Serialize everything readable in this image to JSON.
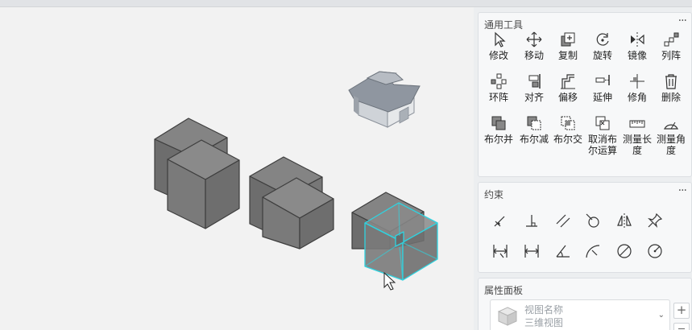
{
  "tools_panel": {
    "title": "通用工具",
    "more": "···",
    "tools": [
      {
        "label": "修改",
        "icon": "cursor-icon"
      },
      {
        "label": "移动",
        "icon": "move-icon"
      },
      {
        "label": "复制",
        "icon": "copy-icon"
      },
      {
        "label": "旋转",
        "icon": "rotate-icon"
      },
      {
        "label": "镜像",
        "icon": "mirror-icon"
      },
      {
        "label": "列阵",
        "icon": "linear-array-icon"
      },
      {
        "label": "环阵",
        "icon": "circular-array-icon"
      },
      {
        "label": "对齐",
        "icon": "align-icon"
      },
      {
        "label": "偏移",
        "icon": "offset-icon"
      },
      {
        "label": "延伸",
        "icon": "extend-icon"
      },
      {
        "label": "修角",
        "icon": "trim-corner-icon"
      },
      {
        "label": "删除",
        "icon": "trash-icon"
      },
      {
        "label": "布尔并",
        "icon": "boolean-union-icon"
      },
      {
        "label": "布尔减",
        "icon": "boolean-subtract-icon"
      },
      {
        "label": "布尔交",
        "icon": "boolean-intersect-icon"
      },
      {
        "label": "取消布尔运算",
        "icon": "cancel-boolean-icon"
      },
      {
        "label": "测量长度",
        "icon": "measure-length-icon"
      },
      {
        "label": "测量角度",
        "icon": "measure-angle-icon"
      }
    ]
  },
  "constraints_panel": {
    "title": "约束",
    "more": "···",
    "icons": [
      "point-on-line-constraint-icon",
      "perpendicular-constraint-icon",
      "parallel-constraint-icon",
      "tangent-constraint-icon",
      "symmetry-constraint-icon",
      "pin-constraint-icon",
      "horizontal-dimension-icon",
      "distance-dimension-icon",
      "angle-dimension-icon",
      "arc-dimension-icon",
      "diameter-dimension-icon",
      "radius-dimension-icon"
    ]
  },
  "properties_panel": {
    "title": "属性面板",
    "view_name_label": "视图名称",
    "view_name_value": "三维视图",
    "add_button": "+",
    "colors": {
      "selection": "#2fd3e0",
      "solid": "#777777"
    }
  }
}
